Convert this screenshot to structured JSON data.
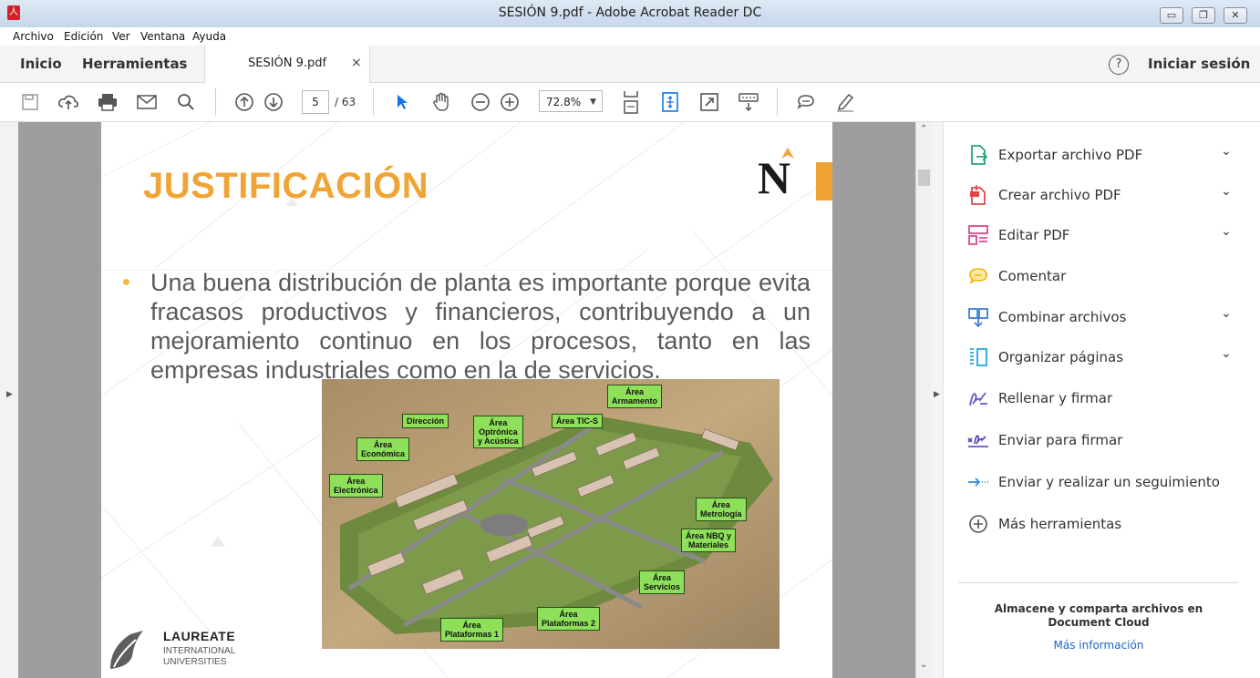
{
  "window": {
    "title": "SESIÓN 9.pdf - Adobe Acrobat Reader DC"
  },
  "menu": [
    "Archivo",
    "Edición",
    "Ver",
    "Ventana",
    "Ayuda"
  ],
  "tabs": {
    "home": "Inicio",
    "tools": "Herramientas",
    "document": "SESIÓN 9.pdf",
    "close": "×"
  },
  "account": {
    "help": "?",
    "signin": "Iniciar sesión"
  },
  "toolbar": {
    "page_current": "5",
    "page_total": "/ 63",
    "zoom": "72.8%"
  },
  "slide": {
    "title": "JUSTIFICACIÓN",
    "body": "Una buena distribución de planta es importante porque evita fracasos productivos y financieros, contribuyendo a un mejoramiento continuo en los procesos, tanto en las empresas industriales como en la de servicios.",
    "logo_name": "LAUREATE",
    "logo_sub1": "INTERNATIONAL",
    "logo_sub2": "UNIVERSITIES",
    "brand_letter": "N",
    "map_labels": {
      "armamento": "Área\nArmamento",
      "direccion": "Dirección",
      "optronica": "Área\nOptrónica\ny Acústica",
      "tics": "Área TIC-S",
      "economica": "Área\nEconómica",
      "electronica": "Área\nElectrónica",
      "metrologia": "Área\nMetrología",
      "nbq": "Área NBQ y\nMateriales",
      "servicios": "Área\nServicios",
      "plataformas2": "Área\nPlataformas 2",
      "plataformas1": "Área\nPlataformas 1"
    }
  },
  "tools_panel": {
    "items": [
      {
        "label": "Exportar archivo PDF",
        "icon": "export-pdf-icon",
        "color": "#2ba676",
        "chevron": true
      },
      {
        "label": "Crear archivo PDF",
        "icon": "create-pdf-icon",
        "color": "#e0454b",
        "chevron": true
      },
      {
        "label": "Editar PDF",
        "icon": "edit-pdf-icon",
        "color": "#e0478c",
        "chevron": true
      },
      {
        "label": "Comentar",
        "icon": "comment-icon",
        "color": "#f4b400",
        "chevron": false
      },
      {
        "label": "Combinar archivos",
        "icon": "combine-files-icon",
        "color": "#3b7fd4",
        "chevron": true
      },
      {
        "label": "Organizar páginas",
        "icon": "organize-pages-icon",
        "color": "#22a6de",
        "chevron": true
      },
      {
        "label": "Rellenar y firmar",
        "icon": "fill-sign-icon",
        "color": "#6b56c8",
        "chevron": false
      },
      {
        "label": "Enviar para firmar",
        "icon": "send-sign-icon",
        "color": "#4a3fb8",
        "chevron": false
      },
      {
        "label": "Enviar y realizar un seguimiento",
        "icon": "send-track-icon",
        "color": "#2f8be0",
        "chevron": false
      },
      {
        "label": "Más herramientas",
        "icon": "more-tools-icon",
        "color": "#555555",
        "chevron": false
      }
    ],
    "cloud_text": "Almacene y comparta archivos en Document Cloud",
    "cloud_link": "Más información"
  }
}
